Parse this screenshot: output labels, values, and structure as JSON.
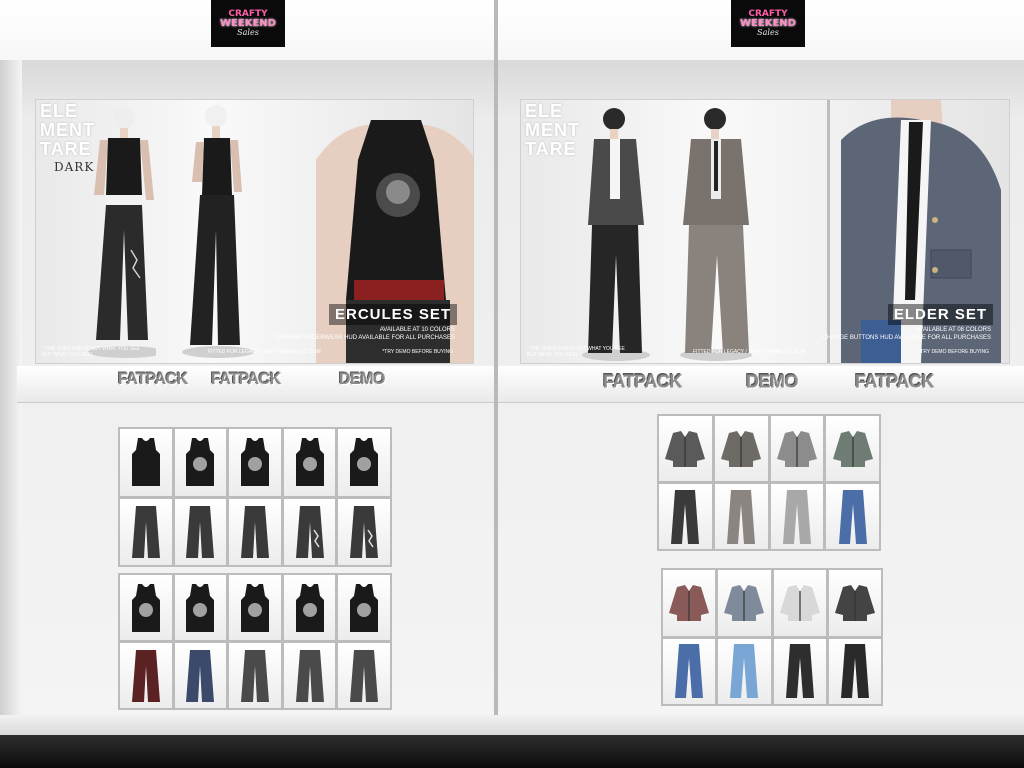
{
  "event": {
    "logo_line1": "CRAFTY",
    "logo_line2": "WEEKEND",
    "logo_line3": "Sales"
  },
  "left_booth": {
    "poster": {
      "brand_lines": [
        "ELE",
        "MENT",
        "TARE"
      ],
      "brand_sub": "DARK",
      "set_title": "ERCULES SET",
      "sub_line1": "AVAILABLE AT 10 COLORS",
      "sub_line2": "CHANGE UNDERWEAR HUD AVAILABLE FOR ALL PURCHASES",
      "foot_left": "* THE QUESTION IS NOT WHAT YOU SEE BUT WHAT YOU FEEL",
      "foot_middle": "FITTED FOR LEGACY / JAKE / GIANNI / EZ SLIM",
      "foot_right": "*TRY DEMO BEFORE BUYING"
    },
    "buttons": [
      "FATPACK",
      "FATPACK",
      "DEMO"
    ],
    "grid1_tops": [
      "black-tank-plain",
      "black-tank-print",
      "black-tank-skull",
      "black-tank-star",
      "black-tank-text"
    ],
    "grid1_pants": [
      "dark-wide-pants",
      "dark-wide-pants",
      "dark-wide-pants",
      "dark-print-pants",
      "dark-cargo-pants"
    ],
    "grid2_tops": [
      "black-tank-logo",
      "black-tank-crest",
      "black-tank-face",
      "black-tank-skull",
      "black-tank-portrait"
    ],
    "grid2_pants": [
      "red-wide-pants",
      "blue-wide-pants",
      "grey-wide-pants",
      "grey-wide-pants",
      "grey-wide-pants"
    ]
  },
  "right_booth": {
    "poster": {
      "brand_lines": [
        "ELE",
        "MENT",
        "TARE"
      ],
      "set_title": "ELDER SET",
      "sub_line1": "AVAILABLE AT 08 COLORS",
      "sub_line2": "CHANGE BUTTONS HUD AVAILABLE FOR ALL PURCHASES",
      "foot_left": "* THE QUESTION IS NOT WHAT YOU SEE BUT WHAT YOU FEEL",
      "foot_middle": "FITTED FOR LEGACY / JAKE / GIANNI / EZ SLIM",
      "foot_right": "*TRY DEMO BEFORE BUYING"
    },
    "buttons": [
      "FATPACK",
      "DEMO",
      "FATPACK"
    ],
    "grid1_jackets": [
      "#5a5a5a",
      "#6e6a66",
      "#8c8c8c",
      "#6f7c74"
    ],
    "grid1_pants": [
      "#3a3a3a",
      "#8a8580",
      "#a8a8a8",
      "#4b6ea8"
    ],
    "grid2_jackets": [
      "#8a5a58",
      "#7f8a9a",
      "#d8d8d8",
      "#444444"
    ],
    "grid2_pants": [
      "#4b6ea8",
      "#7aa6d6",
      "#2e2e2e",
      "#2a2a2a"
    ]
  },
  "colors": {
    "tank": "#1a1a1a",
    "pants_dark": "#3a3a3a",
    "skin": "#e8d2c4"
  }
}
